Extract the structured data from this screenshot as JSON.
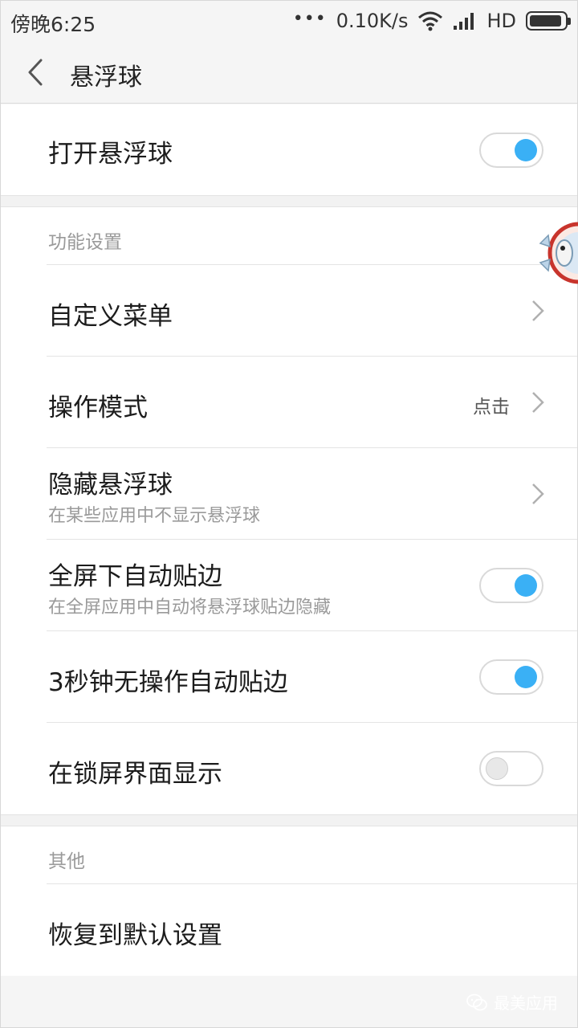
{
  "status_bar": {
    "time": "傍晚6:25",
    "dots": "•••",
    "net_speed": "0.10K/s",
    "network": "HD",
    "icons": [
      "wifi-icon",
      "signal-icon",
      "battery-icon"
    ]
  },
  "header": {
    "title": "悬浮球",
    "back_icon": "chevron-left-icon"
  },
  "main_toggle": {
    "label": "打开悬浮球",
    "on": true
  },
  "function_section": {
    "heading": "功能设置",
    "items": [
      {
        "label": "自定义菜单",
        "type": "link"
      },
      {
        "label": "操作模式",
        "value": "点击",
        "type": "link"
      },
      {
        "label": "隐藏悬浮球",
        "subtitle": "在某些应用中不显示悬浮球",
        "type": "link"
      },
      {
        "label": "全屏下自动贴边",
        "subtitle": "在全屏应用中自动将悬浮球贴边隐藏",
        "type": "toggle",
        "on": true
      },
      {
        "label": "3秒钟无操作自动贴边",
        "type": "toggle",
        "on": true
      },
      {
        "label": "在锁屏界面显示",
        "type": "toggle",
        "on": false
      }
    ]
  },
  "other_section": {
    "heading": "其他",
    "items": [
      {
        "label": "恢复到默认设置",
        "type": "action"
      }
    ]
  },
  "watermark": {
    "text": "最美应用",
    "icon": "wechat-icon"
  },
  "colors": {
    "accent": "#3ab0f5",
    "background": "#f5f5f5",
    "card": "#ffffff",
    "secondary_text": "#9a9a9a"
  }
}
